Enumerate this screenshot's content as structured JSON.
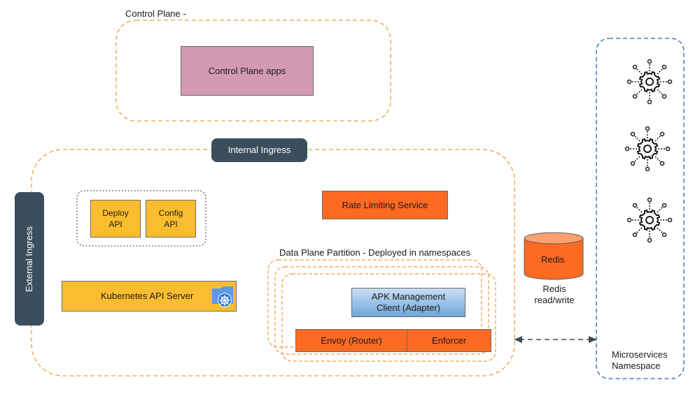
{
  "diagram": {
    "control_plane": {
      "label": "Control Plane -",
      "apps_box": "Control Plane apps"
    },
    "internal_ingress": "Internal Ingress",
    "external_ingress": "External Ingress",
    "api_group": {
      "deploy_api": "Deploy\nAPI",
      "config_api": "Config\nAPI"
    },
    "kubernetes_api_server": "Kubernetes API Server",
    "rate_limiting_service": "Rate Limiting Service",
    "data_plane": {
      "label": "Data Plane Partition - Deployed in namespaces",
      "adapter": "APK Management\nClient (Adapter)",
      "envoy": "Envoy (Router)",
      "enforcer": "Enforcer"
    },
    "redis": {
      "label": "Redis",
      "caption": "Redis\nread/write"
    },
    "microservices": {
      "label": "Microservices\nNamespace",
      "icons": [
        "microservice-icon",
        "microservice-icon",
        "microservice-icon"
      ]
    },
    "colors": {
      "orange_dash": "#f39a43",
      "blue_dash": "#2364b8",
      "dark": "#3c4e5c",
      "pink": "#d49ab2",
      "yellow": "#fbbd2f",
      "orange": "#fe6a22"
    }
  }
}
